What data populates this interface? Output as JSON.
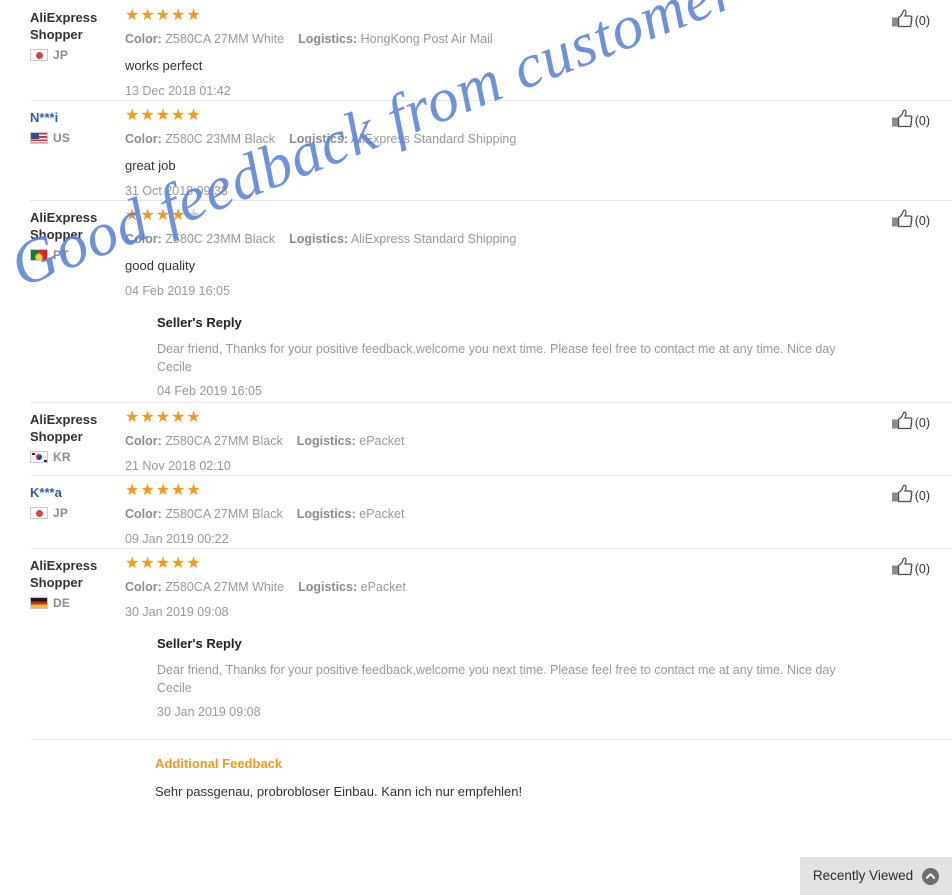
{
  "watermark": {
    "text": "Good feedback from customer",
    "color": "#5b82d6"
  },
  "labels": {
    "color_key": "Color:",
    "logistics_key": "Logistics:",
    "seller_reply_title": "Seller's Reply",
    "additional_feedback_title": "Additional Feedback"
  },
  "theme": {
    "star_on": "#f7971d",
    "star_off": "#cccccc",
    "accent_orange": "#f7971d",
    "link_blue": "#2b5fa3",
    "muted": "#999999"
  },
  "recently_viewed": {
    "label": "Recently Viewed",
    "icon": "chevron-up-circle-icon"
  },
  "reviews": [
    {
      "buyer": "AliExpress Shopper",
      "buyer_is_link": false,
      "country_code": "JP",
      "flag": "flag-jp",
      "stars": 5,
      "color": "Z580CA 27MM White",
      "logistics": "HongKong Post Air Mail",
      "comment": "works perfect",
      "datetime": "13 Dec 2018 01:42",
      "helpful_count": "(0)",
      "reply": null
    },
    {
      "buyer": "N***i",
      "buyer_is_link": true,
      "country_code": "US",
      "flag": "flag-us",
      "stars": 5,
      "color": "Z580C 23MM Black",
      "logistics": "AliExpress Standard Shipping",
      "comment": "great job",
      "datetime": "31 Oct 2018 09:33",
      "helpful_count": "(0)",
      "reply": null
    },
    {
      "buyer": "AliExpress Shopper",
      "buyer_is_link": false,
      "country_code": "PT",
      "flag": "flag-pt",
      "stars": 4,
      "color": "Z580C 23MM Black",
      "logistics": "AliExpress Standard Shipping",
      "comment": "good quality",
      "datetime": "04 Feb 2019 16:05",
      "helpful_count": "(0)",
      "reply": {
        "title": "Seller's Reply",
        "body": "Dear friend, Thanks for your positive feedback,welcome you next time. Please feel free to contact me at any time. Nice day Cecile",
        "datetime": "04 Feb 2019 16:05"
      }
    },
    {
      "buyer": "AliExpress Shopper",
      "buyer_is_link": false,
      "country_code": "KR",
      "flag": "flag-kr",
      "stars": 5,
      "color": "Z580CA 27MM Black",
      "logistics": "ePacket",
      "comment": "",
      "datetime": "21 Nov 2018 02:10",
      "helpful_count": "(0)",
      "reply": null
    },
    {
      "buyer": "K***a",
      "buyer_is_link": true,
      "country_code": "JP",
      "flag": "flag-jp",
      "stars": 5,
      "color": "Z580CA 27MM Black",
      "logistics": "ePacket",
      "comment": "",
      "datetime": "09 Jan 2019 00:22",
      "helpful_count": "(0)",
      "reply": null
    },
    {
      "buyer": "AliExpress Shopper",
      "buyer_is_link": false,
      "country_code": "DE",
      "flag": "flag-de",
      "stars": 5,
      "color": "Z580CA 27MM White",
      "logistics": "ePacket",
      "comment": "",
      "datetime": "30 Jan 2019 09:08",
      "helpful_count": "(0)",
      "reply": {
        "title": "Seller's Reply",
        "body": "Dear friend, Thanks for your positive feedback,welcome you next time. Please feel free to contact me at any time. Nice day Cecile",
        "datetime": "30 Jan 2019 09:08"
      },
      "additional_feedback": {
        "title": "Additional Feedback",
        "body": "Sehr passgenau, probrobloser Einbau. Kann ich nur empfehlen!"
      }
    }
  ]
}
